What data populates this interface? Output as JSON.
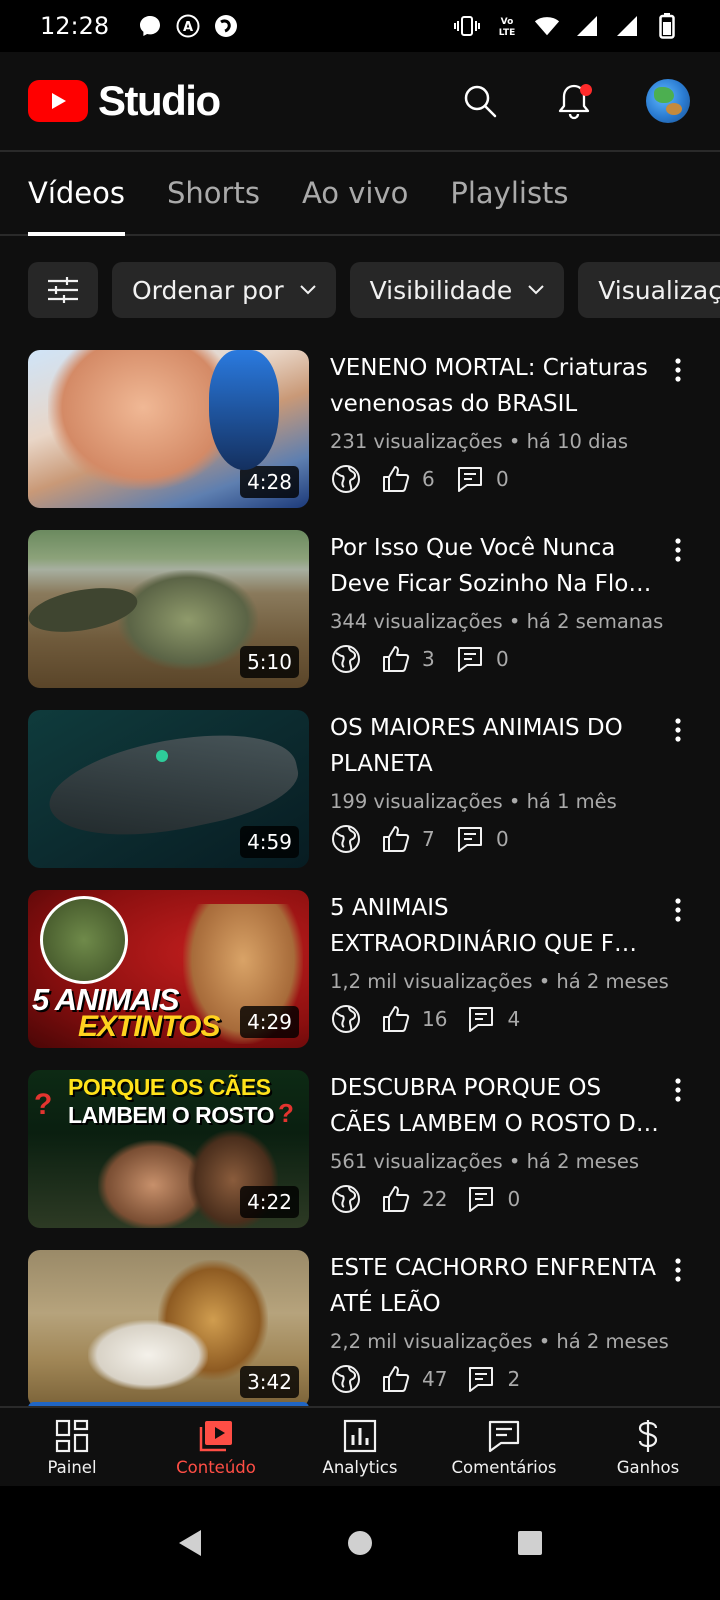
{
  "status_bar": {
    "time": "12:28"
  },
  "header": {
    "app_title": "Studio"
  },
  "tabs": [
    {
      "label": "Vídeos",
      "active": true
    },
    {
      "label": "Shorts",
      "active": false
    },
    {
      "label": "Ao vivo",
      "active": false
    },
    {
      "label": "Playlists",
      "active": false
    }
  ],
  "filters": {
    "icon": "tune-icon",
    "chips": [
      "Ordenar por",
      "Visibilidade",
      "Visualizações"
    ]
  },
  "videos": [
    {
      "title": "VENENO MORTAL: Criaturas venenosas do BRASIL",
      "meta": "231 visualizações • há 10 dias",
      "duration": "4:28",
      "likes": "6",
      "comments": "0"
    },
    {
      "title": "Por Isso Que Você Nunca Deve Ficar Sozinho Na Flo…",
      "meta": "344 visualizações • há 2 semanas",
      "duration": "5:10",
      "likes": "3",
      "comments": "0"
    },
    {
      "title": "OS MAIORES ANIMAIS DO PLANETA",
      "meta": "199 visualizações • há 1 mês",
      "duration": "4:59",
      "likes": "7",
      "comments": "0"
    },
    {
      "title": "5 ANIMAIS EXTRAORDINÁRIO QUE F…",
      "meta": "1,2 mil visualizações • há 2 meses",
      "duration": "4:29",
      "likes": "16",
      "comments": "4",
      "thumb_text": [
        "5 ANIMAIS",
        "EXTINTOS"
      ]
    },
    {
      "title": "DESCUBRA PORQUE OS CÃES LAMBEM O ROSTO D…",
      "meta": "561 visualizações • há 2 meses",
      "duration": "4:22",
      "likes": "22",
      "comments": "0",
      "thumb_text": [
        "PORQUE OS CÃES",
        "LAMBEM O ROSTO",
        "?",
        "?"
      ]
    },
    {
      "title": "ESTE CACHORRO ENFRENTA ATÉ LEÃO",
      "meta": "2,2 mil visualizações • há 2 meses",
      "duration": "3:42",
      "likes": "47",
      "comments": "2"
    }
  ],
  "bottom_nav": [
    {
      "label": "Painel",
      "icon": "dashboard-icon",
      "active": false
    },
    {
      "label": "Conteúdo",
      "icon": "content-icon",
      "active": true
    },
    {
      "label": "Analytics",
      "icon": "analytics-icon",
      "active": false
    },
    {
      "label": "Comentários",
      "icon": "comments-icon",
      "active": false
    },
    {
      "label": "Ganhos",
      "icon": "earn-icon",
      "active": false
    }
  ],
  "colors": {
    "accent": "#ff0000",
    "active_nav": "#ff4e45",
    "background": "#0f0f0f",
    "chip": "#272727"
  }
}
